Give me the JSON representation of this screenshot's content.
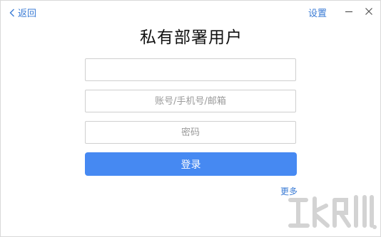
{
  "header": {
    "back_label": "返回",
    "settings_label": "设置"
  },
  "page": {
    "title": "私有部署用户"
  },
  "form": {
    "server_value": "",
    "server_placeholder": "",
    "account_value": "",
    "account_placeholder": "账号/手机号/邮箱",
    "password_value": "",
    "password_placeholder": "密码",
    "login_label": "登录",
    "more_label": "更多"
  },
  "icons": {
    "back": "chevron-left-icon",
    "minimize": "minimize-icon",
    "close": "close-icon",
    "watermark": "watermark-logo"
  },
  "colors": {
    "accent": "#3a7bd5",
    "button": "#4689f2"
  }
}
